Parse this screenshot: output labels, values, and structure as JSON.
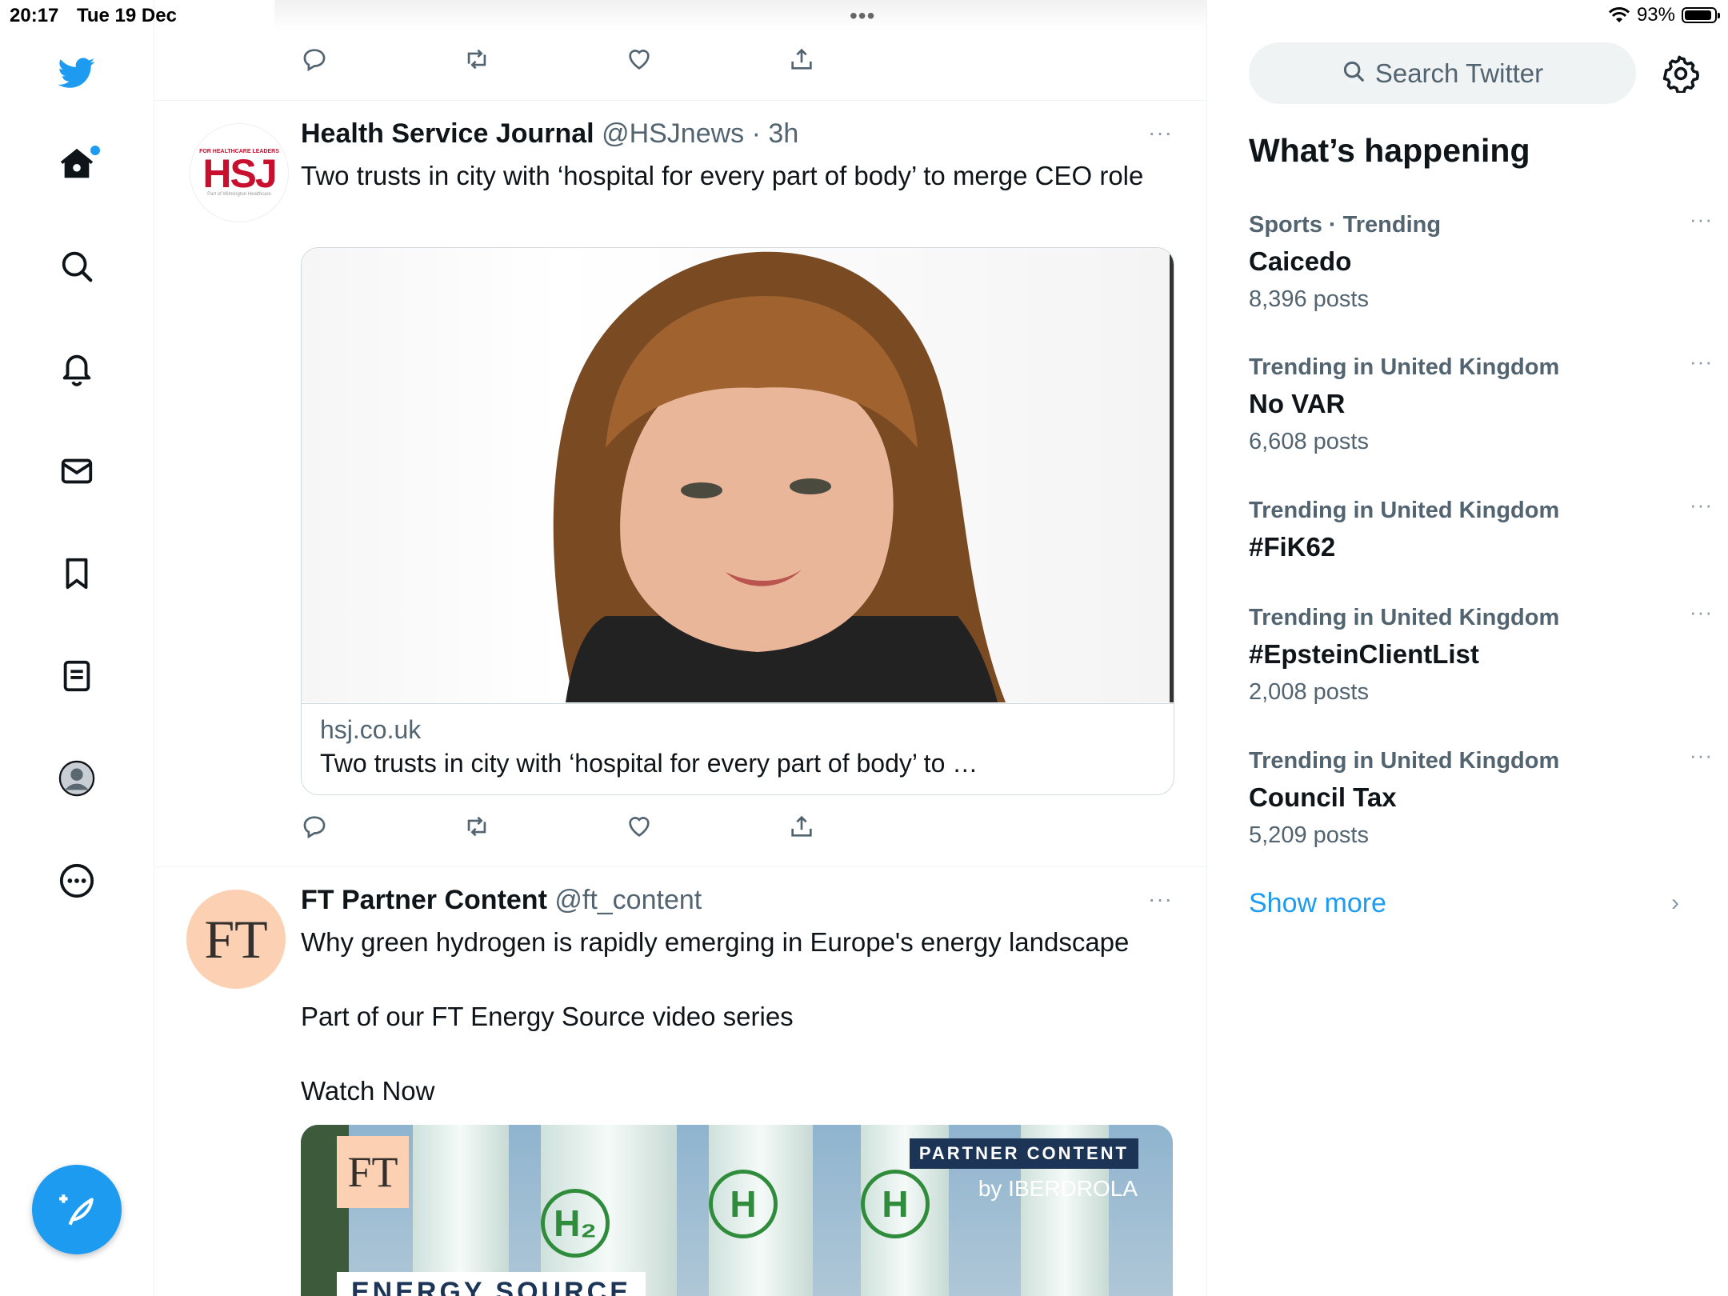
{
  "status_bar": {
    "time": "20:17",
    "date": "Tue 19 Dec",
    "dots": "•••",
    "battery": "93%",
    "battery_level": 0.93
  },
  "icons": {
    "logo": "twitter-bird-icon",
    "home": "home-icon",
    "explore": "search-icon",
    "notifications": "bell-icon",
    "messages": "mail-icon",
    "bookmarks": "bookmark-icon",
    "lists": "lists-icon",
    "profile": "avatar",
    "more": "more-circle-icon",
    "compose": "compose-icon"
  },
  "colors": {
    "accent": "#1d9bf0",
    "text": "#0f1419",
    "muted": "#536471"
  },
  "tweets": [
    {
      "name": "Health Service Journal",
      "handle": "@HSJnews",
      "dot": "·",
      "time": "3h",
      "text": "Two trusts in city with ‘hospital for every part of body’ to merge CEO role",
      "more": "···",
      "avatar": {
        "top": "FOR HEALTHCARE LEADERS",
        "logo": "HSJ",
        "sub": "Part of Wilmington Healthcare"
      },
      "card": {
        "domain": "hsj.co.uk",
        "title": "Two trusts in city with ‘hospital for every part of body’ to …"
      }
    },
    {
      "name": "FT Partner Content",
      "handle": "@ft_content",
      "text_lines": [
        "Why green hydrogen is rapidly emerging in Europe's energy landscape",
        "Part of our FT Energy Source video series",
        "Watch Now"
      ],
      "more": "···",
      "avatar": {
        "logo": "FT"
      },
      "media": {
        "badge": "PARTNER CONTENT",
        "by": "by IBERDROLA",
        "ft": "FT",
        "label": "ENERGY SOURCE",
        "h2": "H₂",
        "h": "H"
      }
    }
  ],
  "sidebar": {
    "search_placeholder": "Search Twitter",
    "title": "What’s happening",
    "more": "···",
    "trends": [
      {
        "context": "Sports · Trending",
        "name": "Caicedo",
        "count": "8,396 posts"
      },
      {
        "context": "Trending in United Kingdom",
        "name": "No VAR",
        "count": "6,608 posts"
      },
      {
        "context": "Trending in United Kingdom",
        "name": "#FiK62",
        "count": ""
      },
      {
        "context": "Trending in United Kingdom",
        "name": "#EpsteinClientList",
        "count": "2,008 posts"
      },
      {
        "context": "Trending in United Kingdom",
        "name": "Council Tax",
        "count": "5,209 posts"
      }
    ],
    "show_more": "Show more",
    "chevron": "›"
  }
}
